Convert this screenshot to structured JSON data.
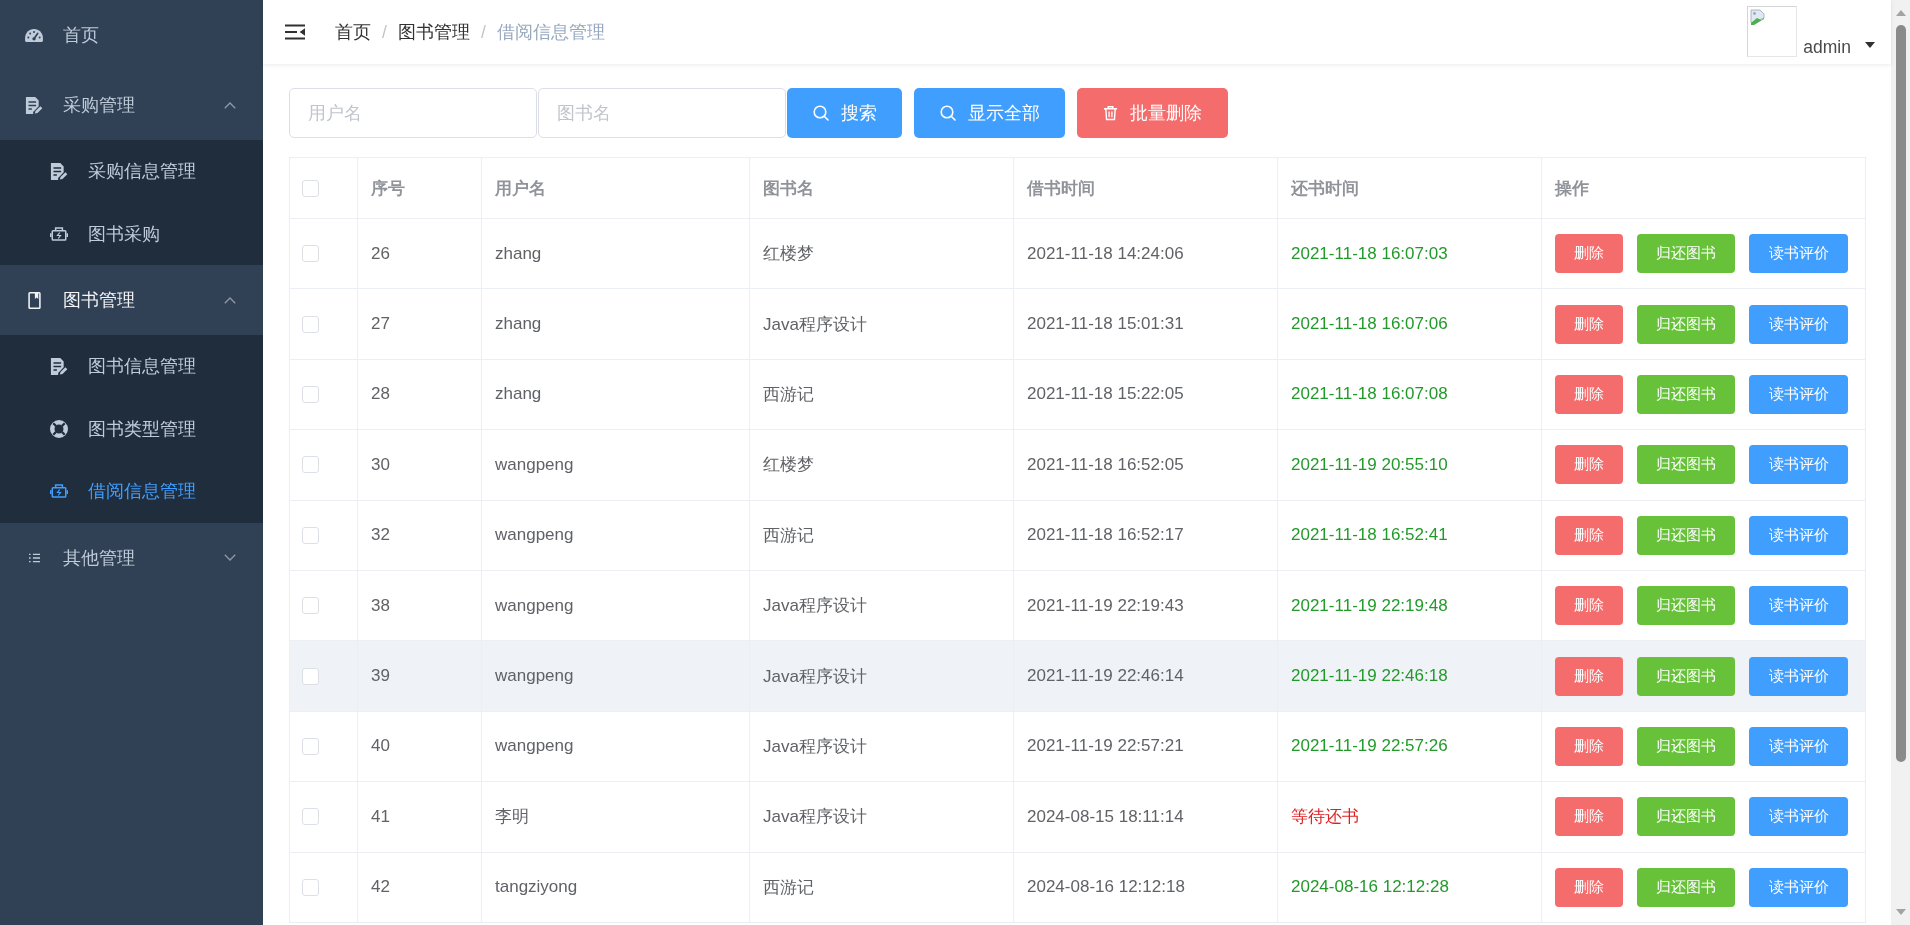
{
  "sidebar": {
    "items": [
      {
        "kind": "link",
        "label": "首页",
        "selected": false
      },
      {
        "kind": "group",
        "label": "采购管理",
        "expanded": true,
        "children": [
          {
            "label": "采购信息管理",
            "selected": false
          },
          {
            "label": "图书采购",
            "selected": false
          }
        ]
      },
      {
        "kind": "group",
        "label": "图书管理",
        "expanded": true,
        "children": [
          {
            "label": "图书信息管理",
            "selected": false
          },
          {
            "label": "图书类型管理",
            "selected": false
          },
          {
            "label": "借阅信息管理",
            "selected": true
          }
        ]
      },
      {
        "kind": "group",
        "label": "其他管理",
        "expanded": false
      }
    ]
  },
  "header": {
    "breadcrumb": [
      {
        "label": "首页",
        "separator": "/",
        "current": false
      },
      {
        "label": "图书管理",
        "separator": "/",
        "current": false
      },
      {
        "label": "借阅信息管理",
        "current": true
      }
    ],
    "user": {
      "name": "admin"
    }
  },
  "toolbar": {
    "fields": [
      {
        "placeholder": "用户名"
      },
      {
        "placeholder": "图书名"
      }
    ],
    "buttons": [
      {
        "label": "搜索",
        "kind": "primary"
      },
      {
        "label": "显示全部",
        "kind": "primary"
      },
      {
        "label": "批量删除",
        "kind": "danger"
      }
    ]
  },
  "table": {
    "select_all": {
      "checked": false
    },
    "columns": [
      "序号",
      "用户名",
      "图书名",
      "借书时间",
      "还书时间",
      "操作"
    ],
    "rows": [
      {
        "checked": false,
        "hovered": false,
        "number": "26",
        "user": "zhang",
        "book": "红楼梦",
        "borrowed": "2021-11-18 14:24:06",
        "return_time": "2021-11-18 16:07:03",
        "returned": true,
        "actions": [
          {
            "label": "删除",
            "kind": "danger"
          },
          {
            "label": "归还图书",
            "kind": "success"
          },
          {
            "label": "读书评价",
            "kind": "primary"
          }
        ]
      },
      {
        "checked": false,
        "hovered": false,
        "number": "27",
        "user": "zhang",
        "book": "Java程序设计",
        "borrowed": "2021-11-18 15:01:31",
        "return_time": "2021-11-18 16:07:06",
        "returned": true,
        "actions": [
          {
            "label": "删除",
            "kind": "danger"
          },
          {
            "label": "归还图书",
            "kind": "success"
          },
          {
            "label": "读书评价",
            "kind": "primary"
          }
        ]
      },
      {
        "checked": false,
        "hovered": false,
        "number": "28",
        "user": "zhang",
        "book": "西游记",
        "borrowed": "2021-11-18 15:22:05",
        "return_time": "2021-11-18 16:07:08",
        "returned": true,
        "actions": [
          {
            "label": "删除",
            "kind": "danger"
          },
          {
            "label": "归还图书",
            "kind": "success"
          },
          {
            "label": "读书评价",
            "kind": "primary"
          }
        ]
      },
      {
        "checked": false,
        "hovered": false,
        "number": "30",
        "user": "wangpeng",
        "book": "红楼梦",
        "borrowed": "2021-11-18 16:52:05",
        "return_time": "2021-11-19 20:55:10",
        "returned": true,
        "actions": [
          {
            "label": "删除",
            "kind": "danger"
          },
          {
            "label": "归还图书",
            "kind": "success"
          },
          {
            "label": "读书评价",
            "kind": "primary"
          }
        ]
      },
      {
        "checked": false,
        "hovered": false,
        "number": "32",
        "user": "wangpeng",
        "book": "西游记",
        "borrowed": "2021-11-18 16:52:17",
        "return_time": "2021-11-18 16:52:41",
        "returned": true,
        "actions": [
          {
            "label": "删除",
            "kind": "danger"
          },
          {
            "label": "归还图书",
            "kind": "success"
          },
          {
            "label": "读书评价",
            "kind": "primary"
          }
        ]
      },
      {
        "checked": false,
        "hovered": false,
        "number": "38",
        "user": "wangpeng",
        "book": "Java程序设计",
        "borrowed": "2021-11-19 22:19:43",
        "return_time": "2021-11-19 22:19:48",
        "returned": true,
        "actions": [
          {
            "label": "删除",
            "kind": "danger"
          },
          {
            "label": "归还图书",
            "kind": "success"
          },
          {
            "label": "读书评价",
            "kind": "primary"
          }
        ]
      },
      {
        "checked": false,
        "hovered": true,
        "number": "39",
        "user": "wangpeng",
        "book": "Java程序设计",
        "borrowed": "2021-11-19 22:46:14",
        "return_time": "2021-11-19 22:46:18",
        "returned": true,
        "actions": [
          {
            "label": "删除",
            "kind": "danger"
          },
          {
            "label": "归还图书",
            "kind": "success"
          },
          {
            "label": "读书评价",
            "kind": "primary"
          }
        ]
      },
      {
        "checked": false,
        "hovered": false,
        "number": "40",
        "user": "wangpeng",
        "book": "Java程序设计",
        "borrowed": "2021-11-19 22:57:21",
        "return_time": "2021-11-19 22:57:26",
        "returned": true,
        "actions": [
          {
            "label": "删除",
            "kind": "danger"
          },
          {
            "label": "归还图书",
            "kind": "success"
          },
          {
            "label": "读书评价",
            "kind": "primary"
          }
        ]
      },
      {
        "checked": false,
        "hovered": false,
        "number": "41",
        "user": "李明",
        "book": "Java程序设计",
        "borrowed": "2024-08-15 18:11:14",
        "return_time": "等待还书",
        "returned": false,
        "actions": [
          {
            "label": "删除",
            "kind": "danger"
          },
          {
            "label": "归还图书",
            "kind": "success"
          },
          {
            "label": "读书评价",
            "kind": "primary"
          }
        ]
      },
      {
        "checked": false,
        "hovered": false,
        "number": "42",
        "user": "tangziyong",
        "book": "西游记",
        "borrowed": "2024-08-16 12:12:18",
        "return_time": "2024-08-16 12:12:28",
        "returned": true,
        "actions": [
          {
            "label": "删除",
            "kind": "danger"
          },
          {
            "label": "归还图书",
            "kind": "success"
          },
          {
            "label": "读书评价",
            "kind": "primary"
          }
        ]
      }
    ]
  }
}
